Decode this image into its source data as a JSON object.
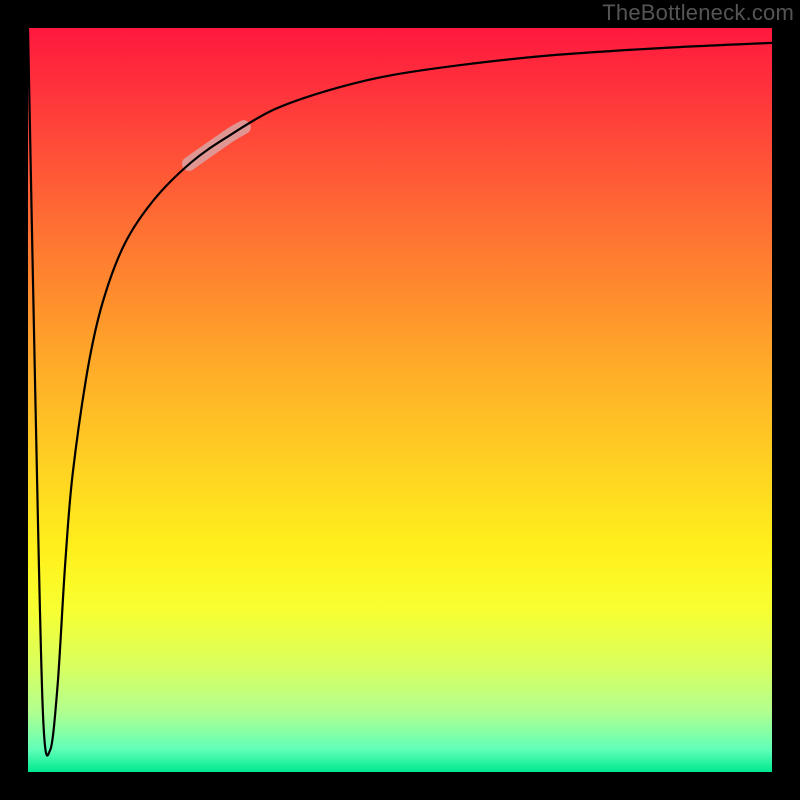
{
  "attribution": "TheBottleneck.com",
  "chart_data": {
    "type": "line",
    "title": "",
    "xlabel": "",
    "ylabel": "",
    "xlim": [
      0,
      100
    ],
    "ylim": [
      0,
      100
    ],
    "series": [
      {
        "name": "curve",
        "x": [
          0,
          1,
          2,
          3,
          4,
          5,
          6,
          8,
          10,
          13,
          17,
          22,
          27,
          33,
          40,
          48,
          58,
          70,
          85,
          100
        ],
        "y": [
          100,
          50,
          8,
          3,
          12,
          28,
          40,
          54,
          63,
          71,
          77,
          82,
          85.5,
          89,
          91.5,
          93.5,
          95,
          96.3,
          97.3,
          98
        ]
      }
    ],
    "highlight_segment": {
      "x_start": 22,
      "x_end": 29,
      "note": "faded pink emphasis on curve"
    },
    "background_gradient": {
      "direction": "vertical",
      "stops": [
        {
          "pos": 0.0,
          "color": "#ff183e"
        },
        {
          "pos": 0.35,
          "color": "#ff8a2e"
        },
        {
          "pos": 0.7,
          "color": "#fff01c"
        },
        {
          "pos": 1.0,
          "color": "#00e890"
        }
      ]
    }
  }
}
